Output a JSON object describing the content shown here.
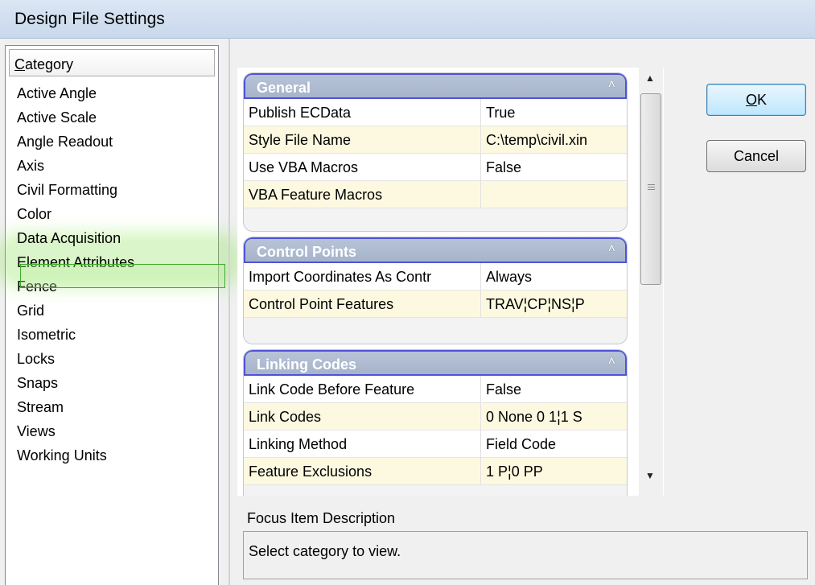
{
  "window": {
    "title": "Design File Settings"
  },
  "category": {
    "header_first": "C",
    "header_rest": "ategory",
    "items": [
      "Active Angle",
      "Active Scale",
      "Angle Readout",
      "Axis",
      "Civil Formatting",
      "Color",
      "Data Acquisition",
      "Element Attributes",
      "Fence",
      "Grid",
      "Isometric",
      "Locks",
      "Snaps",
      "Stream",
      "Views",
      "Working Units"
    ],
    "selected": "Data Acquisition"
  },
  "groups": {
    "general": {
      "title": "General",
      "rows": [
        {
          "name": "Publish ECData",
          "value": "True"
        },
        {
          "name": "Style File Name",
          "value": "C:\\temp\\civil.xin"
        },
        {
          "name": "Use VBA Macros",
          "value": "False"
        },
        {
          "name": "VBA Feature Macros",
          "value": ""
        }
      ]
    },
    "control_points": {
      "title": "Control Points",
      "rows": [
        {
          "name": "Import Coordinates As Contr",
          "value": "Always"
        },
        {
          "name": "Control Point Features",
          "value": "TRAV¦CP¦NS¦P"
        }
      ]
    },
    "linking_codes": {
      "title": "Linking Codes",
      "rows": [
        {
          "name": "Link Code Before Feature",
          "value": "False"
        },
        {
          "name": "Link Codes",
          "value": "0 None 0 1¦1 S"
        },
        {
          "name": "Linking Method",
          "value": "Field Code"
        },
        {
          "name": "Feature  Exclusions",
          "value": "1 P¦0 PP"
        }
      ]
    }
  },
  "buttons": {
    "ok_first": "O",
    "ok_rest": "K",
    "cancel": "Cancel"
  },
  "focus": {
    "label": "Focus Item Description",
    "text": "Select category to view."
  },
  "icons": {
    "collapse": "collapse-icon",
    "scroll_up": "scroll-up-arrow-icon",
    "scroll_down": "scroll-down-arrow-icon"
  },
  "colors": {
    "group_border": "#4f52d6",
    "selection": "#3caa2a",
    "alt_row": "#fdf9e0"
  }
}
